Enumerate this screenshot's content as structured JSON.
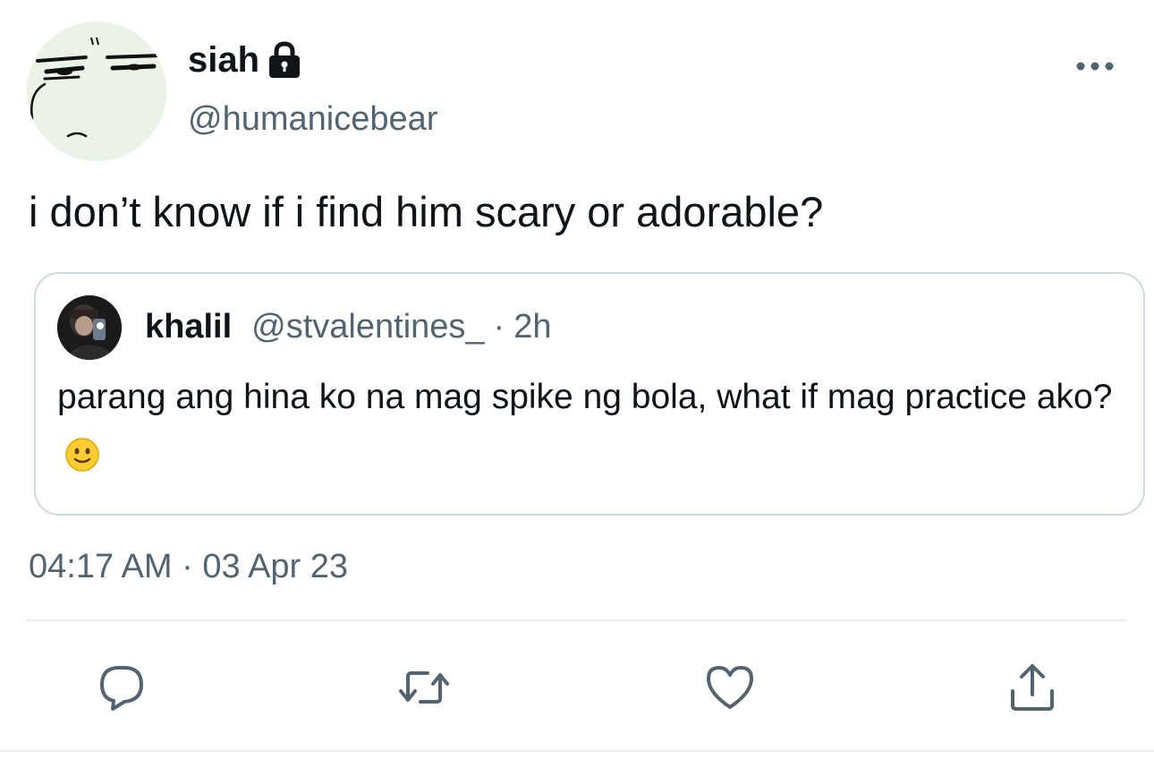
{
  "author": {
    "display_name": "siah",
    "handle": "@humanicebear",
    "protected": true,
    "avatar_icon": "bear-face-avatar"
  },
  "tweet": {
    "text": "i don’t know if i find him scary or adorable?",
    "time": "04:17 AM",
    "separator": "·",
    "date": "03 Apr 23"
  },
  "quoted_tweet": {
    "display_name": "khalil",
    "handle": "@stvalentines_",
    "separator": "·",
    "age": "2h",
    "text": "parang ang hina ko na mag spike ng bola, what if mag practice ako?",
    "emoji": "slightly-smiling-face"
  },
  "actions": {
    "reply_icon": "reply-icon",
    "retweet_icon": "retweet-icon",
    "like_icon": "heart-icon",
    "share_icon": "share-icon"
  },
  "colors": {
    "text_primary": "#0f1419",
    "text_secondary": "#536471",
    "border": "#cfd9de",
    "icon": "#536471",
    "avatar_bg": "#eaf3e6"
  }
}
